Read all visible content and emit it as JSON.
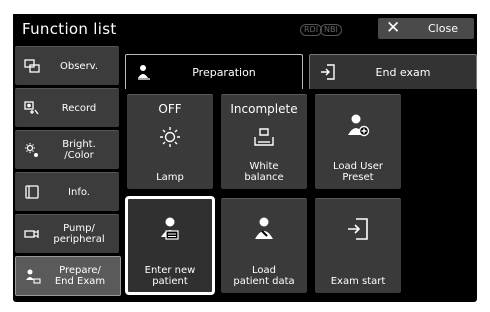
{
  "window": {
    "title": "Function list",
    "badge_left": "RDI",
    "badge_right": "NBI",
    "close_label": "Close"
  },
  "sidebar": {
    "items": [
      {
        "label": "Observ.",
        "icon": "observation-icon",
        "active": false
      },
      {
        "label": "Record",
        "icon": "record-icon",
        "active": false
      },
      {
        "label": "Bright.\n/Color",
        "icon": "brightness-icon",
        "active": false
      },
      {
        "label": "Info.",
        "icon": "info-icon",
        "active": false
      },
      {
        "label": "Pump/\nperipheral",
        "icon": "pump-icon",
        "active": false
      },
      {
        "label": "Prepare/\nEnd Exam",
        "icon": "prepare-icon",
        "active": true
      }
    ]
  },
  "tabs": [
    {
      "label": "Preparation",
      "icon": "preparation-icon",
      "active": true
    },
    {
      "label": "End exam",
      "icon": "end-exam-icon",
      "active": false
    }
  ],
  "tiles": [
    {
      "state": "OFF",
      "label": "Lamp",
      "icon": "lamp-icon"
    },
    {
      "state": "Incomplete",
      "label": "White\nbalance",
      "icon": "white-balance-icon"
    },
    {
      "state": "",
      "label": "Load User\nPreset",
      "icon": "load-user-preset-icon"
    },
    {
      "state": "",
      "label": "Enter new\npatient",
      "icon": "enter-new-patient-icon",
      "selected": true
    },
    {
      "state": "",
      "label": "Load\npatient data",
      "icon": "load-patient-data-icon"
    },
    {
      "state": "",
      "label": "Exam start",
      "icon": "exam-start-icon"
    }
  ]
}
